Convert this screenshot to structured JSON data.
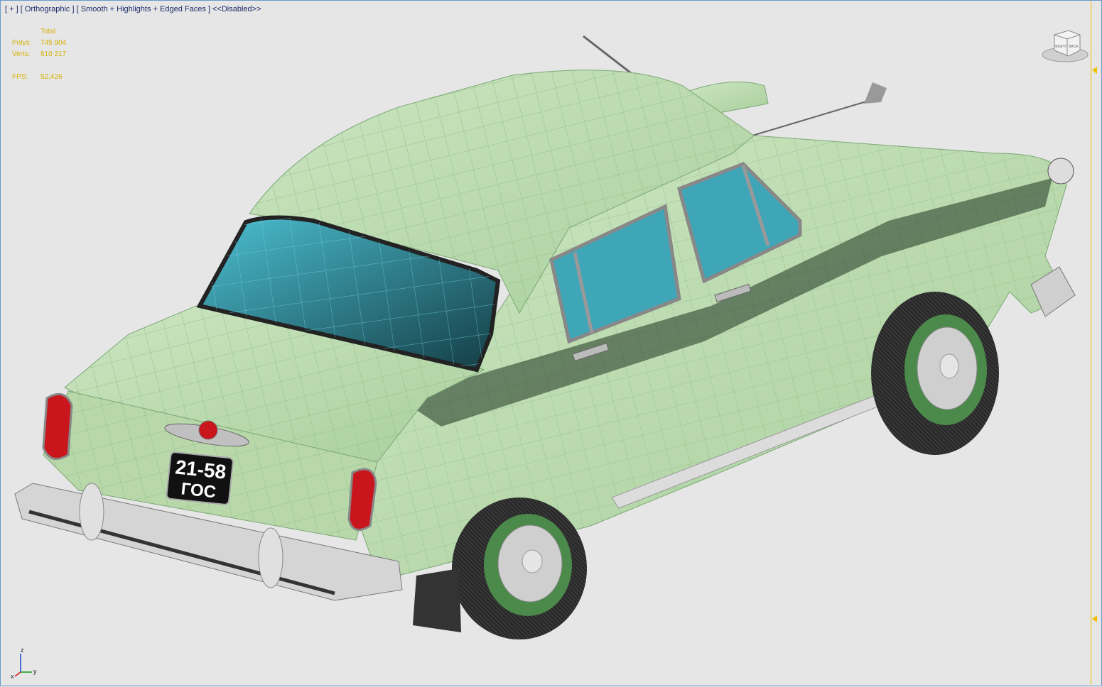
{
  "viewport": {
    "label_plus": "[ + ]",
    "label_view": "[ Orthographic ]",
    "label_shading": "[ Smooth + Highlights + Edged Faces ]",
    "label_disabled": "<<Disabled>>"
  },
  "stats": {
    "header": "Total",
    "polys_label": "Polys:",
    "polys_value": "745 904",
    "verts_label": "Verts:",
    "verts_value": "610 217",
    "fps_label": "FPS:",
    "fps_value": "52,426"
  },
  "viewcube": {
    "face_right": "RIGHT",
    "face_back": "BACK"
  },
  "axis": {
    "z": "z",
    "x": "x",
    "y": "y"
  },
  "license_plate": {
    "number": "21-58",
    "region": "ГОС"
  },
  "colors": {
    "body_green": "#bcdcb0",
    "wire_green": "#8ab884",
    "glass_blue": "#3fa6b8",
    "glass_dark": "#1d5c66",
    "chrome": "#c9c9c9",
    "tire": "#2a2a2a",
    "taillight_red": "#c8161c",
    "stats_yellow": "#d8b000",
    "label_blue": "#1a2a6a"
  }
}
